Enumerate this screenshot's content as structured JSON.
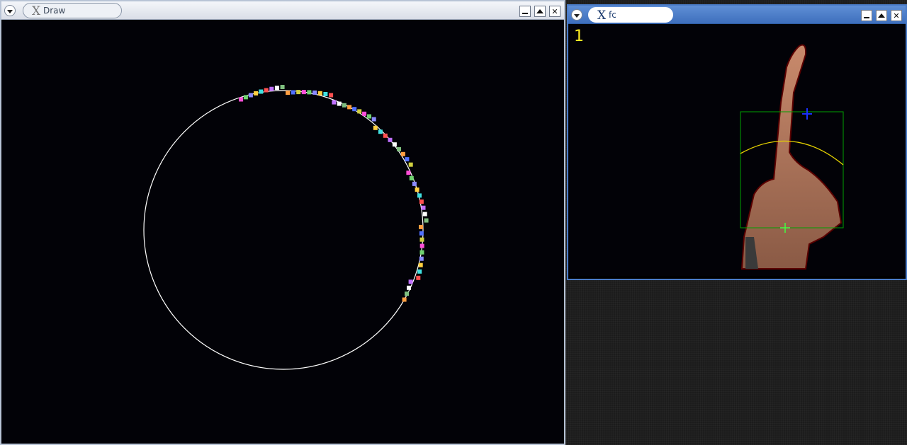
{
  "windows": {
    "draw": {
      "title": "Draw"
    },
    "fc": {
      "title": "fc",
      "counter": "1"
    }
  },
  "colors": {
    "circle": "#ffffff",
    "bbox": "#00a000",
    "arc": "#e6d200",
    "top_marker": "#1a30ff",
    "center_marker": "#40ff40",
    "counter": "#ffee22",
    "title_active": "#4a7cc8"
  },
  "icons": [
    "window-menu-icon",
    "x-logo-icon",
    "minimize-icon",
    "maximize-icon",
    "close-icon"
  ]
}
